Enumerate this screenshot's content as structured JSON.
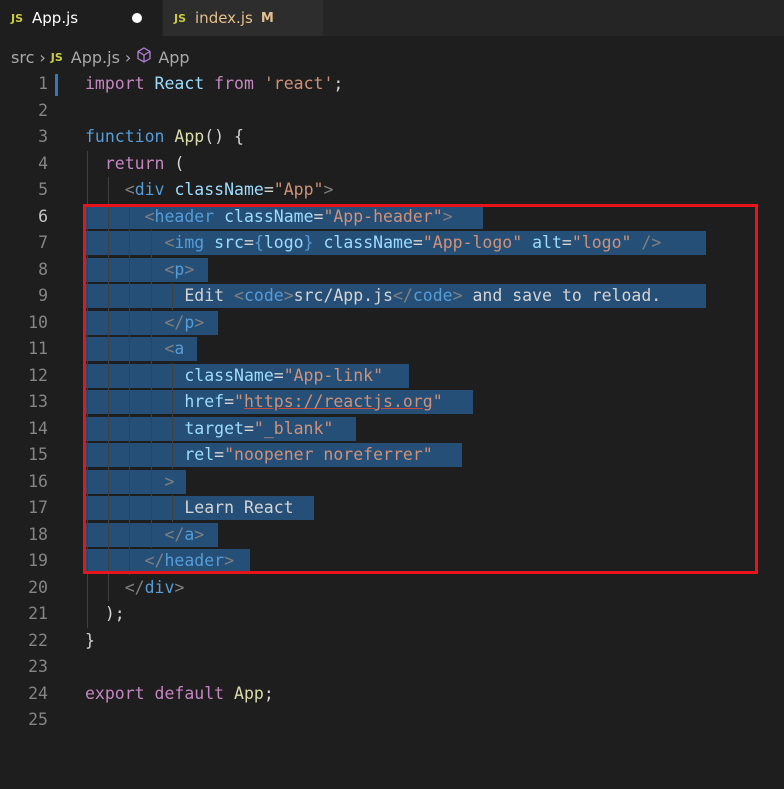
{
  "tabs": [
    {
      "icon": "JS",
      "label": "App.js",
      "dirty": true
    },
    {
      "icon": "JS",
      "label": "index.js",
      "badge": "M"
    }
  ],
  "breadcrumb": [
    "src",
    "App.js",
    "App"
  ],
  "colors": {
    "keyword": "#c586c0",
    "keyword_blue": "#569cd6",
    "function": "#dcdcaa",
    "string": "#ce9178",
    "attribute": "#9cdcfe",
    "selection": "#264f78",
    "highlight_box": "#e8141c",
    "js_badge": "#cbcb41"
  },
  "code_lines": [
    {
      "n": "1",
      "tokens": [
        [
          "kw",
          "import"
        ],
        [
          "txt",
          " "
        ],
        [
          "var",
          "React"
        ],
        [
          "txt",
          " "
        ],
        [
          "kw",
          "from"
        ],
        [
          "txt",
          " "
        ],
        [
          "str",
          "'react'"
        ],
        [
          "txt",
          ";"
        ]
      ]
    },
    {
      "n": "2",
      "tokens": []
    },
    {
      "n": "3",
      "tokens": [
        [
          "kwb",
          "function"
        ],
        [
          "txt",
          " "
        ],
        [
          "fn",
          "App"
        ],
        [
          "txt",
          "() {"
        ]
      ]
    },
    {
      "n": "4",
      "tokens": [
        [
          "txt",
          "  "
        ],
        [
          "kw",
          "return"
        ],
        [
          "txt",
          " ("
        ]
      ]
    },
    {
      "n": "5",
      "tokens": [
        [
          "txt",
          "    "
        ],
        [
          "punct",
          "<"
        ],
        [
          "tag",
          "div"
        ],
        [
          "txt",
          " "
        ],
        [
          "attr",
          "className"
        ],
        [
          "txt",
          "="
        ],
        [
          "str",
          "\"App\""
        ],
        [
          "punct",
          ">"
        ]
      ]
    },
    {
      "n": "6",
      "tokens": [
        [
          "txt",
          "      "
        ],
        [
          "punct",
          "<"
        ],
        [
          "tag",
          "header"
        ],
        [
          "txt",
          " "
        ],
        [
          "attr",
          "className"
        ],
        [
          "txt",
          "="
        ],
        [
          "str",
          "\"App-header\""
        ],
        [
          "punct",
          ">"
        ]
      ]
    },
    {
      "n": "7",
      "tokens": [
        [
          "txt",
          "        "
        ],
        [
          "punct",
          "<"
        ],
        [
          "tag",
          "img"
        ],
        [
          "txt",
          " "
        ],
        [
          "attr",
          "src"
        ],
        [
          "txt",
          "="
        ],
        [
          "kwb",
          "{"
        ],
        [
          "var",
          "logo"
        ],
        [
          "kwb",
          "}"
        ],
        [
          "txt",
          " "
        ],
        [
          "attr",
          "className"
        ],
        [
          "txt",
          "="
        ],
        [
          "str",
          "\"App-logo\""
        ],
        [
          "txt",
          " "
        ],
        [
          "attr",
          "alt"
        ],
        [
          "txt",
          "="
        ],
        [
          "str",
          "\"logo\""
        ],
        [
          "txt",
          " "
        ],
        [
          "punct",
          "/>"
        ]
      ]
    },
    {
      "n": "8",
      "tokens": [
        [
          "txt",
          "        "
        ],
        [
          "punct",
          "<"
        ],
        [
          "tag",
          "p"
        ],
        [
          "punct",
          ">"
        ]
      ]
    },
    {
      "n": "9",
      "tokens": [
        [
          "txt",
          "          Edit "
        ],
        [
          "punct",
          "<"
        ],
        [
          "tag",
          "code"
        ],
        [
          "punct",
          ">"
        ],
        [
          "txt",
          "src/App.js"
        ],
        [
          "punct",
          "</"
        ],
        [
          "tag",
          "code"
        ],
        [
          "punct",
          ">"
        ],
        [
          "txt",
          " and save to reload."
        ]
      ]
    },
    {
      "n": "10",
      "tokens": [
        [
          "txt",
          "        "
        ],
        [
          "punct",
          "</"
        ],
        [
          "tag",
          "p"
        ],
        [
          "punct",
          ">"
        ]
      ]
    },
    {
      "n": "11",
      "tokens": [
        [
          "txt",
          "        "
        ],
        [
          "punct",
          "<"
        ],
        [
          "tag",
          "a"
        ]
      ]
    },
    {
      "n": "12",
      "tokens": [
        [
          "txt",
          "          "
        ],
        [
          "attr",
          "className"
        ],
        [
          "txt",
          "="
        ],
        [
          "str",
          "\"App-link\""
        ]
      ]
    },
    {
      "n": "13",
      "tokens": [
        [
          "txt",
          "          "
        ],
        [
          "attr",
          "href"
        ],
        [
          "txt",
          "="
        ],
        [
          "str",
          "\""
        ],
        [
          "str url",
          "https://reactjs.org"
        ],
        [
          "str",
          "\""
        ]
      ]
    },
    {
      "n": "14",
      "tokens": [
        [
          "txt",
          "          "
        ],
        [
          "attr",
          "target"
        ],
        [
          "txt",
          "="
        ],
        [
          "str",
          "\"_blank\""
        ]
      ]
    },
    {
      "n": "15",
      "tokens": [
        [
          "txt",
          "          "
        ],
        [
          "attr",
          "rel"
        ],
        [
          "txt",
          "="
        ],
        [
          "str",
          "\"noopener noreferrer\""
        ]
      ]
    },
    {
      "n": "16",
      "tokens": [
        [
          "txt",
          "        "
        ],
        [
          "punct",
          ">"
        ]
      ]
    },
    {
      "n": "17",
      "tokens": [
        [
          "txt",
          "          Learn React"
        ]
      ]
    },
    {
      "n": "18",
      "tokens": [
        [
          "txt",
          "        "
        ],
        [
          "punct",
          "</"
        ],
        [
          "tag",
          "a"
        ],
        [
          "punct",
          ">"
        ]
      ]
    },
    {
      "n": "19",
      "tokens": [
        [
          "txt",
          "      "
        ],
        [
          "punct",
          "</"
        ],
        [
          "tag",
          "header"
        ],
        [
          "punct",
          ">"
        ]
      ]
    },
    {
      "n": "20",
      "tokens": [
        [
          "txt",
          "    "
        ],
        [
          "punct",
          "</"
        ],
        [
          "tag",
          "div"
        ],
        [
          "punct",
          ">"
        ]
      ]
    },
    {
      "n": "21",
      "tokens": [
        [
          "txt",
          "  );"
        ]
      ]
    },
    {
      "n": "22",
      "tokens": [
        [
          "txt",
          "}"
        ]
      ]
    },
    {
      "n": "23",
      "tokens": []
    },
    {
      "n": "24",
      "tokens": [
        [
          "kw",
          "export"
        ],
        [
          "txt",
          " "
        ],
        [
          "kw",
          "default"
        ],
        [
          "txt",
          " "
        ],
        [
          "fn",
          "App"
        ],
        [
          "txt",
          ";"
        ]
      ]
    },
    {
      "n": "25",
      "tokens": []
    }
  ]
}
